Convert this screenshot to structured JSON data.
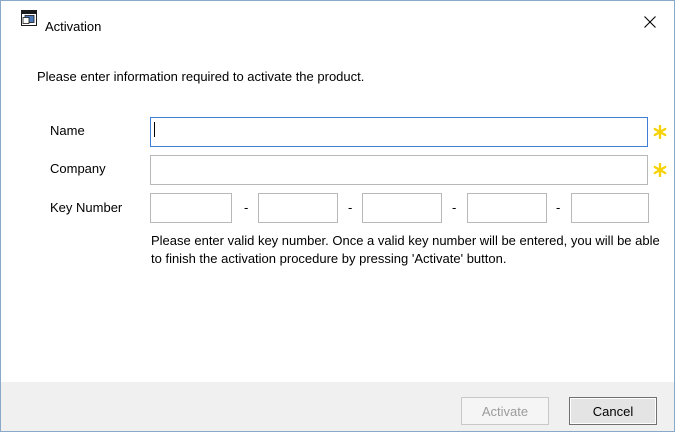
{
  "window": {
    "title": "Activation",
    "icon": "app-window-icon",
    "close_icon": "close-icon"
  },
  "instruction": "Please enter information required to activate the product.",
  "form": {
    "name_label": "Name",
    "name_value": "",
    "company_label": "Company",
    "company_value": "",
    "key_label": "Key Number",
    "key_parts": [
      "",
      "",
      "",
      "",
      ""
    ],
    "key_separator": "-",
    "required_icon": "asterisk-icon",
    "required_color": "#f5d20a"
  },
  "hint": "Please enter valid key number. Once a valid key number will be entered, you will be able to finish the activation procedure by pressing 'Activate' button.",
  "buttons": {
    "activate_label": "Activate",
    "activate_enabled": false,
    "cancel_label": "Cancel"
  }
}
